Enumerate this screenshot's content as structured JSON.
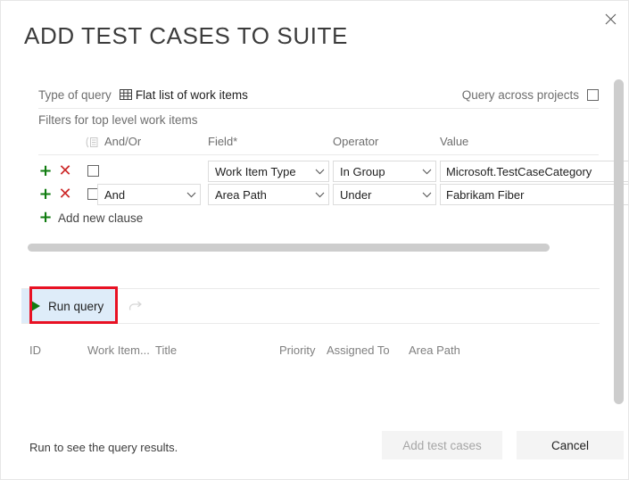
{
  "dialog": {
    "title": "ADD TEST CASES TO SUITE",
    "close_icon": "close-icon"
  },
  "query": {
    "type_label": "Type of query",
    "type_value": "Flat list of work items",
    "type_icon": "flat-list-grid-icon",
    "across_projects_label": "Query across projects",
    "across_projects_checked": false
  },
  "filters": {
    "section_label": "Filters for top level work items",
    "group_icon": "group-clause-icon",
    "columns": {
      "andor": "And/Or",
      "field": "Field*",
      "operator": "Operator",
      "value": "Value"
    },
    "add_icon": "plus-icon",
    "delete_icon": "delete-x-icon",
    "chevron_icon": "chevron-down-icon",
    "rows": [
      {
        "andor": "",
        "field": "Work Item Type",
        "operator": "In Group",
        "value": "Microsoft.TestCaseCategory",
        "checked": false
      },
      {
        "andor": "And",
        "field": "Area Path",
        "operator": "Under",
        "value": "Fabrikam Fiber",
        "checked": false
      }
    ],
    "add_clause_label": "Add new clause"
  },
  "toolbar": {
    "run_query_label": "Run query",
    "run_query_icon": "play-triangle-icon",
    "redo_icon": "redo-arrow-icon"
  },
  "results": {
    "columns": [
      "ID",
      "Work Item...",
      "Title",
      "Priority",
      "Assigned To",
      "Area Path"
    ]
  },
  "footer": {
    "status_text": "Run to see the query results.",
    "add_button": "Add test cases",
    "cancel_button": "Cancel"
  },
  "colors": {
    "accent_green": "#107c10",
    "delete_red": "#cc2929",
    "annotation_red": "#e81123",
    "run_query_bg": "#deecf9",
    "scrollbar": "#cdcdcd"
  }
}
